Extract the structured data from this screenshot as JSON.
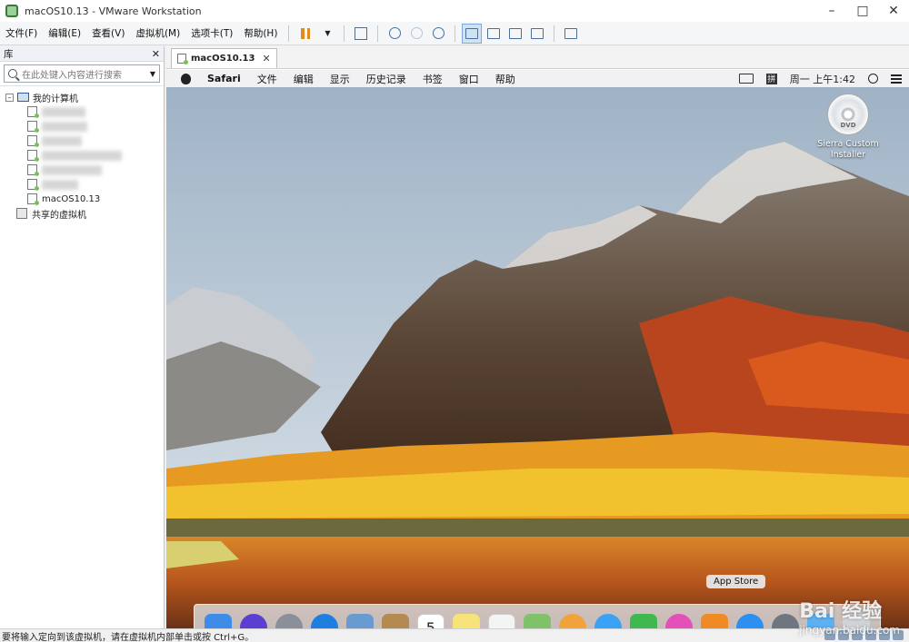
{
  "window": {
    "title": "macOS10.13 - VMware Workstation"
  },
  "menu": [
    "文件(F)",
    "编辑(E)",
    "查看(V)",
    "虚拟机(M)",
    "选项卡(T)",
    "帮助(H)"
  ],
  "library": {
    "header": "库",
    "search_placeholder": "在此处键入内容进行搜索",
    "root": "我的计算机",
    "vm_selected": "macOS10.13",
    "shared": "共享的虚拟机"
  },
  "tab": {
    "label": "macOS10.13"
  },
  "mac": {
    "app_name": "Safari",
    "menus": [
      "文件",
      "编辑",
      "显示",
      "历史记录",
      "书签",
      "窗口",
      "帮助"
    ],
    "ime": "拼",
    "clock": "周一 上午1:42",
    "desktop_item": "Sierra Custom Installer",
    "dvd_text": "DVD",
    "tooltip": "App Store",
    "dock": [
      {
        "name": "finder-icon",
        "color": "#3d8ce8"
      },
      {
        "name": "siri-icon",
        "color": "#5b3fd0"
      },
      {
        "name": "launchpad-icon",
        "color": "#8a8f99"
      },
      {
        "name": "safari-icon",
        "color": "#1e7fe0"
      },
      {
        "name": "mail-icon",
        "color": "#6a9bd0"
      },
      {
        "name": "contacts-icon",
        "color": "#b58a50"
      },
      {
        "name": "calendar-icon",
        "color": "#ffffff"
      },
      {
        "name": "notes-icon",
        "color": "#f8e27a"
      },
      {
        "name": "reminders-icon",
        "color": "#f4f4f4"
      },
      {
        "name": "maps-icon",
        "color": "#7fc26a"
      },
      {
        "name": "photos-icon",
        "color": "#f2a23a"
      },
      {
        "name": "messages-icon",
        "color": "#3aa2f5"
      },
      {
        "name": "facetime-icon",
        "color": "#3fb84f"
      },
      {
        "name": "itunes-icon",
        "color": "#e44fb8"
      },
      {
        "name": "ibooks-icon",
        "color": "#f08a24"
      },
      {
        "name": "app-store-icon",
        "color": "#2d8ff0"
      },
      {
        "name": "system-preferences-icon",
        "color": "#6f7680"
      },
      {
        "name": "folder-icon",
        "color": "#5fb0f0"
      },
      {
        "name": "trash-icon",
        "color": "#d0d4d8"
      }
    ],
    "calendar_day": "5"
  },
  "status": {
    "text": "要将输入定向到该虚拟机，请在虚拟机内部单击或按 Ctrl+G。"
  },
  "watermark": {
    "text": "Bai 经验",
    "url": "jingyan.baidu.com"
  }
}
